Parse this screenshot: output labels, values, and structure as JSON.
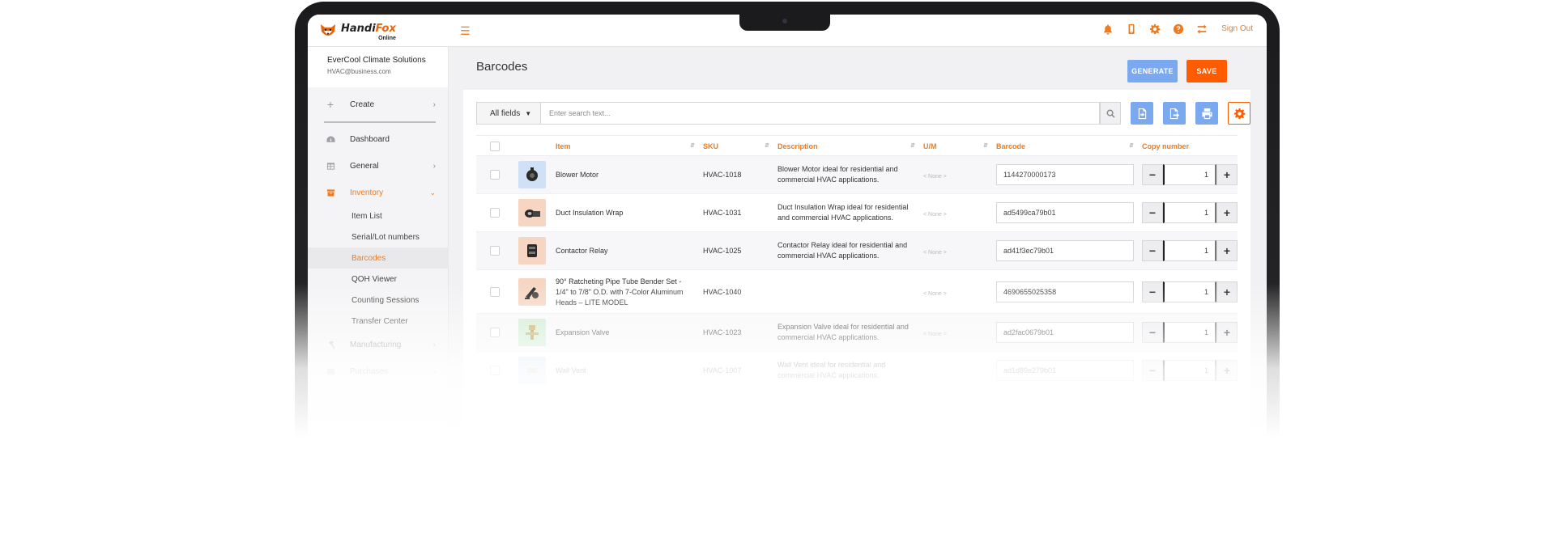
{
  "app": {
    "name_part1": "Handi",
    "name_part2": "Fox",
    "name_sub": "Online"
  },
  "topbar": {
    "sign_out": "Sign Out"
  },
  "company": {
    "name": "EverCool Climate Solutions",
    "email": "HVAC@business.com"
  },
  "sidebar": {
    "create": "Create",
    "items": [
      {
        "label": "Dashboard"
      },
      {
        "label": "General"
      },
      {
        "label": "Inventory"
      },
      {
        "label": "Manufacturing"
      },
      {
        "label": "Purchases"
      }
    ],
    "inventory_sub": [
      "Item List",
      "Serial/Lot numbers",
      "Barcodes",
      "QOH Viewer",
      "Counting Sessions",
      "Transfer Center"
    ]
  },
  "page": {
    "title": "Barcodes",
    "generate": "GENERATE",
    "save": "SAVE"
  },
  "search": {
    "field_filter": "All fields",
    "placeholder": "Enter search text..."
  },
  "table": {
    "headers": {
      "item": "Item",
      "sku": "SKU",
      "description": "Description",
      "um": "U/M",
      "barcode": "Barcode",
      "copy_number": "Copy number"
    },
    "rows": [
      {
        "item": "Blower Motor",
        "sku": "HVAC-1018",
        "description": "Blower Motor ideal for residential and commercial HVAC applications.",
        "um": "< None >",
        "barcode": "1144270000173",
        "copies": "1"
      },
      {
        "item": "Duct Insulation Wrap",
        "sku": "HVAC-1031",
        "description": "Duct Insulation Wrap ideal for residential and commercial HVAC applications.",
        "um": "< None >",
        "barcode": "ad5499ca79b01",
        "copies": "1"
      },
      {
        "item": "Contactor Relay",
        "sku": "HVAC-1025",
        "description": "Contactor Relay ideal for residential and commercial HVAC applications.",
        "um": "< None >",
        "barcode": "ad41f3ec79b01",
        "copies": "1"
      },
      {
        "item": "90° Ratcheting Pipe Tube Bender Set - 1/4\" to 7/8\" O.D. with 7-Color Aluminum Heads – LITE MODEL",
        "sku": "HVAC-1040",
        "description": "",
        "um": "< None >",
        "barcode": "4690655025358",
        "copies": "1"
      },
      {
        "item": "Expansion Valve",
        "sku": "HVAC-1023",
        "description": "Expansion Valve ideal for residential and commercial HVAC applications.",
        "um": "< None >",
        "barcode": "ad2fac0679b01",
        "copies": "1"
      },
      {
        "item": "Wall Vent",
        "sku": "HVAC-1007",
        "description": "Wall Vent ideal for residential and commercial HVAC applications.",
        "um": "",
        "barcode": "ad1d89e279b01",
        "copies": "1"
      }
    ]
  },
  "colors": {
    "accent": "#f07a1e",
    "save": "#ff5b00",
    "tool_blue": "#7aa9f0"
  },
  "icons": [
    "bell-icon",
    "mobile-icon",
    "gear-icon",
    "help-icon",
    "sync-icon",
    "hamburger-icon",
    "search-icon",
    "import-icon",
    "export-icon",
    "print-icon",
    "settings-icon"
  ]
}
